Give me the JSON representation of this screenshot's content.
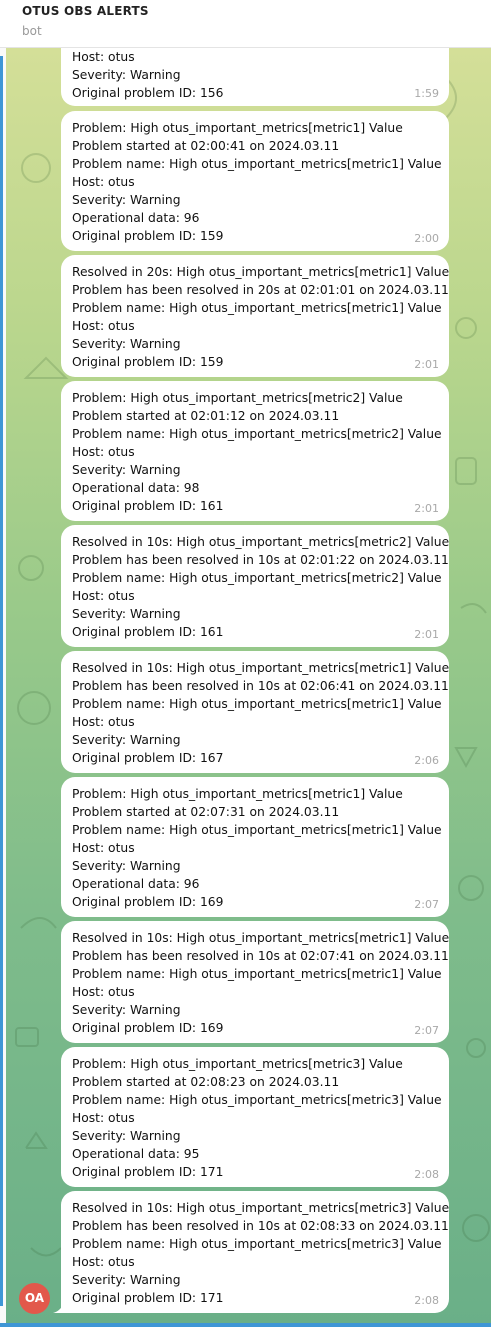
{
  "header": {
    "title": "OTUS OBS ALERTS",
    "subtitle": "bot"
  },
  "avatar": {
    "initials": "OA",
    "color": "#e2584b"
  },
  "colors": {
    "accent": "#3f96d6",
    "bubble": "#ffffff",
    "time": "#a9a9a9"
  },
  "messages": [
    {
      "lines": [
        "Host: otus",
        "Severity: Warning",
        "Original problem ID: 156"
      ],
      "time": "1:59"
    },
    {
      "lines": [
        "Problem: High otus_important_metrics[metric1] Value",
        "Problem started at 02:00:41 on 2024.03.11",
        "Problem name: High otus_important_metrics[metric1] Value",
        "Host: otus",
        "Severity: Warning",
        "Operational data: 96",
        "Original problem ID: 159"
      ],
      "time": "2:00"
    },
    {
      "lines": [
        "Resolved in 20s: High otus_important_metrics[metric1] Value",
        "Problem has been resolved in 20s at 02:01:01 on 2024.03.11",
        "Problem name: High otus_important_metrics[metric1] Value",
        "Host: otus",
        "Severity: Warning",
        "Original problem ID: 159"
      ],
      "time": "2:01"
    },
    {
      "lines": [
        "Problem: High otus_important_metrics[metric2] Value",
        "Problem started at 02:01:12 on 2024.03.11",
        "Problem name: High otus_important_metrics[metric2] Value",
        "Host: otus",
        "Severity: Warning",
        "Operational data: 98",
        "Original problem ID: 161"
      ],
      "time": "2:01"
    },
    {
      "lines": [
        "Resolved in 10s: High otus_important_metrics[metric2] Value",
        "Problem has been resolved in 10s at 02:01:22 on 2024.03.11",
        "Problem name: High otus_important_metrics[metric2] Value",
        "Host: otus",
        "Severity: Warning",
        "Original problem ID: 161"
      ],
      "time": "2:01"
    },
    {
      "lines": [
        "Resolved in 10s: High otus_important_metrics[metric1] Value",
        "Problem has been resolved in 10s at 02:06:41 on 2024.03.11",
        "Problem name: High otus_important_metrics[metric1] Value",
        "Host: otus",
        "Severity: Warning",
        "Original problem ID: 167"
      ],
      "time": "2:06"
    },
    {
      "lines": [
        "Problem: High otus_important_metrics[metric1] Value",
        "Problem started at 02:07:31 on 2024.03.11",
        "Problem name: High otus_important_metrics[metric1] Value",
        "Host: otus",
        "Severity: Warning",
        "Operational data: 96",
        "Original problem ID: 169"
      ],
      "time": "2:07"
    },
    {
      "lines": [
        "Resolved in 10s: High otus_important_metrics[metric1] Value",
        "Problem has been resolved in 10s at 02:07:41 on 2024.03.11",
        "Problem name: High otus_important_metrics[metric1] Value",
        "Host: otus",
        "Severity: Warning",
        "Original problem ID: 169"
      ],
      "time": "2:07"
    },
    {
      "lines": [
        "Problem: High otus_important_metrics[metric3] Value",
        "Problem started at 02:08:23 on 2024.03.11",
        "Problem name: High otus_important_metrics[metric3] Value",
        "Host: otus",
        "Severity: Warning",
        "Operational data: 95",
        "Original problem ID: 171"
      ],
      "time": "2:08"
    },
    {
      "lines": [
        "Resolved in 10s: High otus_important_metrics[metric3] Value",
        "Problem has been resolved in 10s at 02:08:33 on 2024.03.11",
        "Problem name: High otus_important_metrics[metric3] Value",
        "Host: otus",
        "Severity: Warning",
        "Original problem ID: 171"
      ],
      "time": "2:08"
    }
  ]
}
